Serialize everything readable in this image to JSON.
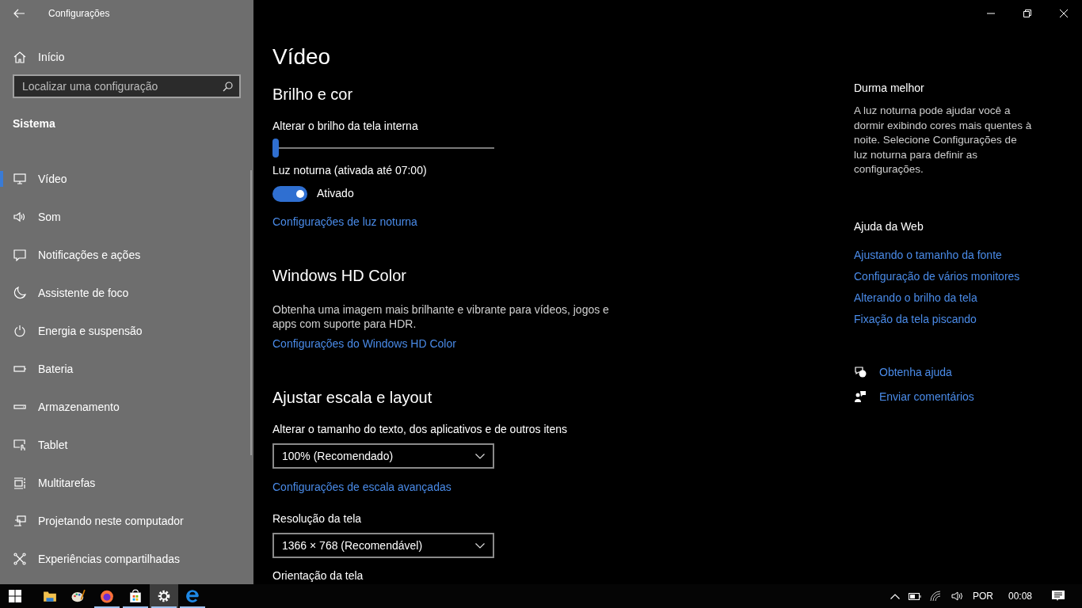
{
  "window": {
    "title": "Configurações"
  },
  "sidebar": {
    "home": "Início",
    "search": {
      "placeholder": "Localizar uma configuração"
    },
    "section": "Sistema",
    "items": [
      {
        "label": "Vídeo",
        "selected": true
      },
      {
        "label": "Som",
        "selected": false
      },
      {
        "label": "Notificações e ações",
        "selected": false
      },
      {
        "label": "Assistente de foco",
        "selected": false
      },
      {
        "label": "Energia e suspensão",
        "selected": false
      },
      {
        "label": "Bateria",
        "selected": false
      },
      {
        "label": "Armazenamento",
        "selected": false
      },
      {
        "label": "Tablet",
        "selected": false
      },
      {
        "label": "Multitarefas",
        "selected": false
      },
      {
        "label": "Projetando neste computador",
        "selected": false
      },
      {
        "label": "Experiências compartilhadas",
        "selected": false
      }
    ]
  },
  "page": {
    "title": "Vídeo",
    "blocks": [
      {
        "kind": "heading",
        "text": "Brilho e cor"
      },
      {
        "kind": "label",
        "text": "Alterar o brilho da tela interna"
      },
      {
        "kind": "slider",
        "level": 0.0
      },
      {
        "kind": "label",
        "text": "Luz noturna (ativada até 07:00)"
      },
      {
        "kind": "toggle",
        "on": true,
        "text": "Ativado"
      },
      {
        "kind": "link",
        "text": "Configurações de luz noturna"
      },
      {
        "kind": "heading",
        "text": "Windows HD Color"
      },
      {
        "kind": "paragraph",
        "text": "Obtenha uma imagem mais brilhante e vibrante para vídeos, jogos e apps com suporte para HDR."
      },
      {
        "kind": "link",
        "text": "Configurações do Windows HD Color"
      },
      {
        "kind": "heading",
        "text": "Ajustar escala e layout"
      },
      {
        "kind": "label",
        "text": "Alterar o tamanho do texto, dos aplicativos e de outros itens"
      },
      {
        "kind": "dropdown",
        "text": "100% (Recomendado)"
      },
      {
        "kind": "link",
        "text": "Configurações de escala avançadas"
      },
      {
        "kind": "label",
        "text": "Resolução da tela"
      },
      {
        "kind": "dropdown",
        "text": "1366 × 768 (Recomendável)"
      },
      {
        "kind": "label",
        "text": "Orientação da tela"
      }
    ]
  },
  "aside": {
    "sleep_title": "Durma melhor",
    "sleep_text": "A luz noturna pode ajudar você a dormir exibindo cores mais quentes à noite. Selecione Configurações de luz noturna para definir as configurações.",
    "web_title": "Ajuda da Web",
    "web_links": [
      "Ajustando o tamanho da fonte",
      "Configuração de vários monitores",
      "Alterando o brilho da tela",
      "Fixação da tela piscando"
    ],
    "actions": [
      "Obtenha ajuda",
      "Enviar comentários"
    ]
  },
  "taskbar": {
    "apps": [
      {
        "kind": "explorer",
        "running": false,
        "selected": false
      },
      {
        "kind": "paint",
        "running": false,
        "selected": false
      },
      {
        "kind": "firefox",
        "running": true,
        "selected": false
      },
      {
        "kind": "store",
        "running": true,
        "selected": false
      },
      {
        "kind": "settings",
        "running": true,
        "selected": true
      },
      {
        "kind": "edge",
        "running": true,
        "selected": false
      }
    ],
    "language": "POR",
    "time": "00:08"
  }
}
